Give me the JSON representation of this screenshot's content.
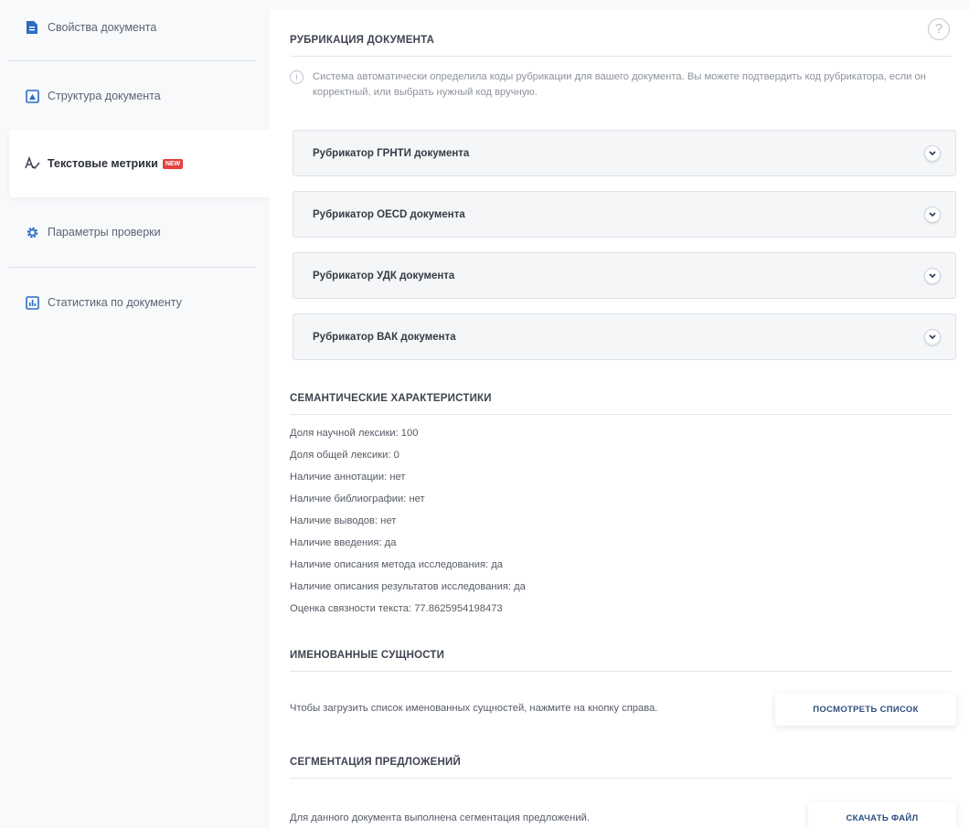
{
  "sidebar": {
    "items": [
      {
        "label": "Свойства документа",
        "icon": "document-icon"
      },
      {
        "label": "Структура документа",
        "icon": "structure-icon"
      },
      {
        "label": "Текстовые метрики",
        "icon": "text-metrics-icon",
        "badge": "NEW",
        "active": true
      },
      {
        "label": "Параметры проверки",
        "icon": "gear-icon"
      },
      {
        "label": "Статистика по документу",
        "icon": "bar-chart-icon"
      }
    ]
  },
  "rubrication": {
    "title": "РУБРИКАЦИЯ ДОКУМЕНТА",
    "help_symbol": "?",
    "info_symbol": "i",
    "info_text": "Система автоматически определила коды рубрикации для вашего документа. Вы можете подтвердить код рубрикатора, если он корректный, или выбрать нужный код вручную.",
    "rubricators": [
      "Рубрикатор ГРНТИ документа",
      "Рубрикатор OECD документа",
      "Рубрикатор УДК документа",
      "Рубрикатор ВАК документа"
    ]
  },
  "semantic": {
    "title": "СЕМАНТИЧЕСКИЕ ХАРАКТЕРИСТИКИ",
    "lines": [
      "Доля научной лексики: 100",
      "Доля общей лексики: 0",
      "Наличие аннотации: нет",
      "Наличие библиографии: нет",
      "Наличие выводов: нет",
      "Наличие введения: да",
      "Наличие описания метода исследования: да",
      "Наличие описания результатов исследования: да",
      "Оценка связности текста: 77.8625954198473"
    ]
  },
  "entities": {
    "title": "ИМЕНОВАННЫЕ СУЩНОСТИ",
    "description": "Чтобы загрузить список именованных сущностей, нажмите на кнопку справа.",
    "button": "ПОСМОТРЕТЬ СПИСОК"
  },
  "segmentation": {
    "title": "СЕГМЕНТАЦИЯ ПРЕДЛОЖЕНИЙ",
    "description": "Для данного документа выполнена сегментация предложений.",
    "button": "СКАЧАТЬ ФАЙЛ"
  },
  "colors": {
    "accent": "#2b6cc4",
    "badge": "#e4413f",
    "button_text": "#2b4e7f"
  }
}
